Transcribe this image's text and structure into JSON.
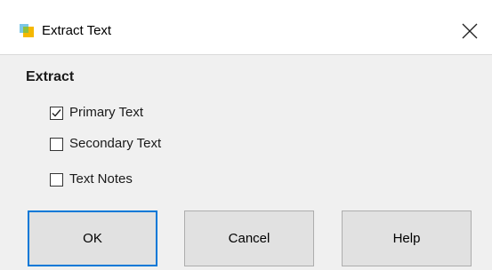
{
  "window": {
    "title": "Extract Text"
  },
  "extract": {
    "section_label": "Extract",
    "options": [
      {
        "label": "Primary Text",
        "checked": true
      },
      {
        "label": "Secondary Text",
        "checked": false
      },
      {
        "label": "Text Notes",
        "checked": false
      }
    ]
  },
  "buttons": {
    "ok": "OK",
    "cancel": "Cancel",
    "help": "Help"
  },
  "colors": {
    "accent": "#0078d7",
    "button_face": "#e1e1e1",
    "dialog_bg": "#f0f0f0"
  },
  "icons": {
    "app": "app-logo-icon",
    "close": "close-icon",
    "check": "checkmark-icon"
  }
}
